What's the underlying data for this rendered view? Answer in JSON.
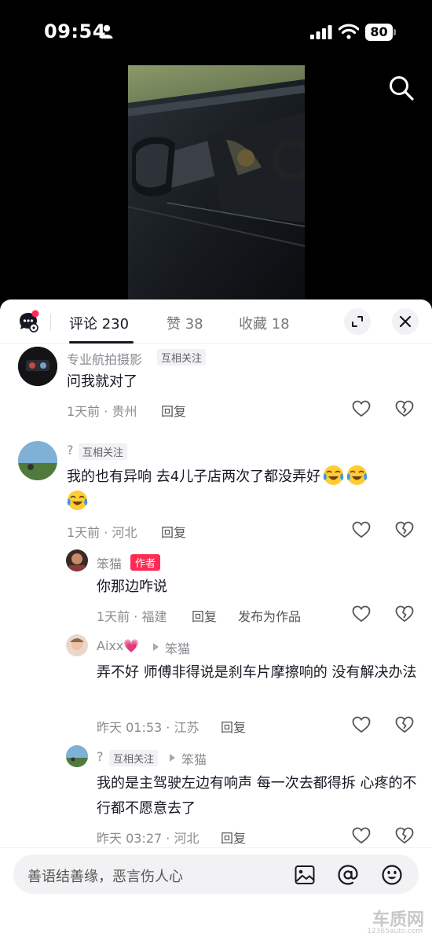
{
  "status_bar": {
    "time": "09:54",
    "battery": "80"
  },
  "tabs": [
    {
      "label": "评论 230"
    },
    {
      "label": "赞 38"
    },
    {
      "label": "收藏 18"
    }
  ],
  "comments": [
    {
      "user": "专业航拍摄影",
      "tag": "互相关注",
      "text": "问我就对了",
      "meta": "1天前 · 贵州",
      "reply": "回复"
    },
    {
      "user": "?",
      "tag": "互相关注",
      "text": "我的也有异响 去4儿子店两次了都没弄好",
      "meta": "1天前 · 河北",
      "reply": "回复"
    },
    {
      "user": "笨猫",
      "author_tag": "作者",
      "text": "你那边咋说",
      "meta": "1天前 · 福建",
      "reply": "回复",
      "publish": "发布为作品"
    },
    {
      "user": "Aixx💗",
      "reply_to": "笨猫",
      "text": "弄不好 师傅非得说是刹车片摩擦响的 没有解决办法",
      "meta": "昨天 01:53 · 江苏",
      "reply": "回复"
    },
    {
      "user": "?",
      "tag": "互相关注",
      "reply_to": "笨猫",
      "text": "我的是主驾驶左边有响声 每一次去都得拆 心疼的不行都不愿意去了",
      "meta": "昨天 03:27 · 河北",
      "reply": "回复"
    }
  ],
  "input": {
    "placeholder": "善语结善缘，恶言伤人心"
  },
  "watermark": {
    "brand": "车质网",
    "url": "12365auto.com"
  },
  "colors": {
    "accent": "#fe2c55",
    "sheet_bg": "#ffffff",
    "meta": "#8a8b91"
  }
}
